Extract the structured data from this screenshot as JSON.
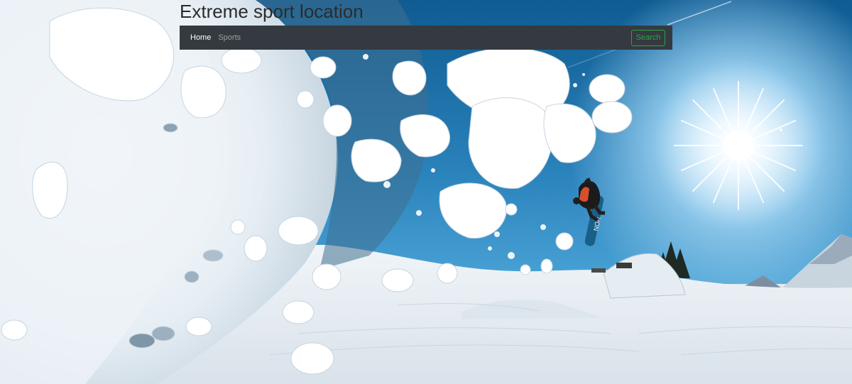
{
  "page": {
    "title": "Extreme sport location"
  },
  "navbar": {
    "links": [
      {
        "label": "Home",
        "active": true
      },
      {
        "label": "Sports",
        "active": false
      }
    ],
    "search_label": "Search"
  },
  "colors": {
    "navbar_bg": "#343a40",
    "search_accent": "#28a745"
  },
  "hero_image": {
    "subject": "snowboarder-jump-with-snow-spray"
  }
}
